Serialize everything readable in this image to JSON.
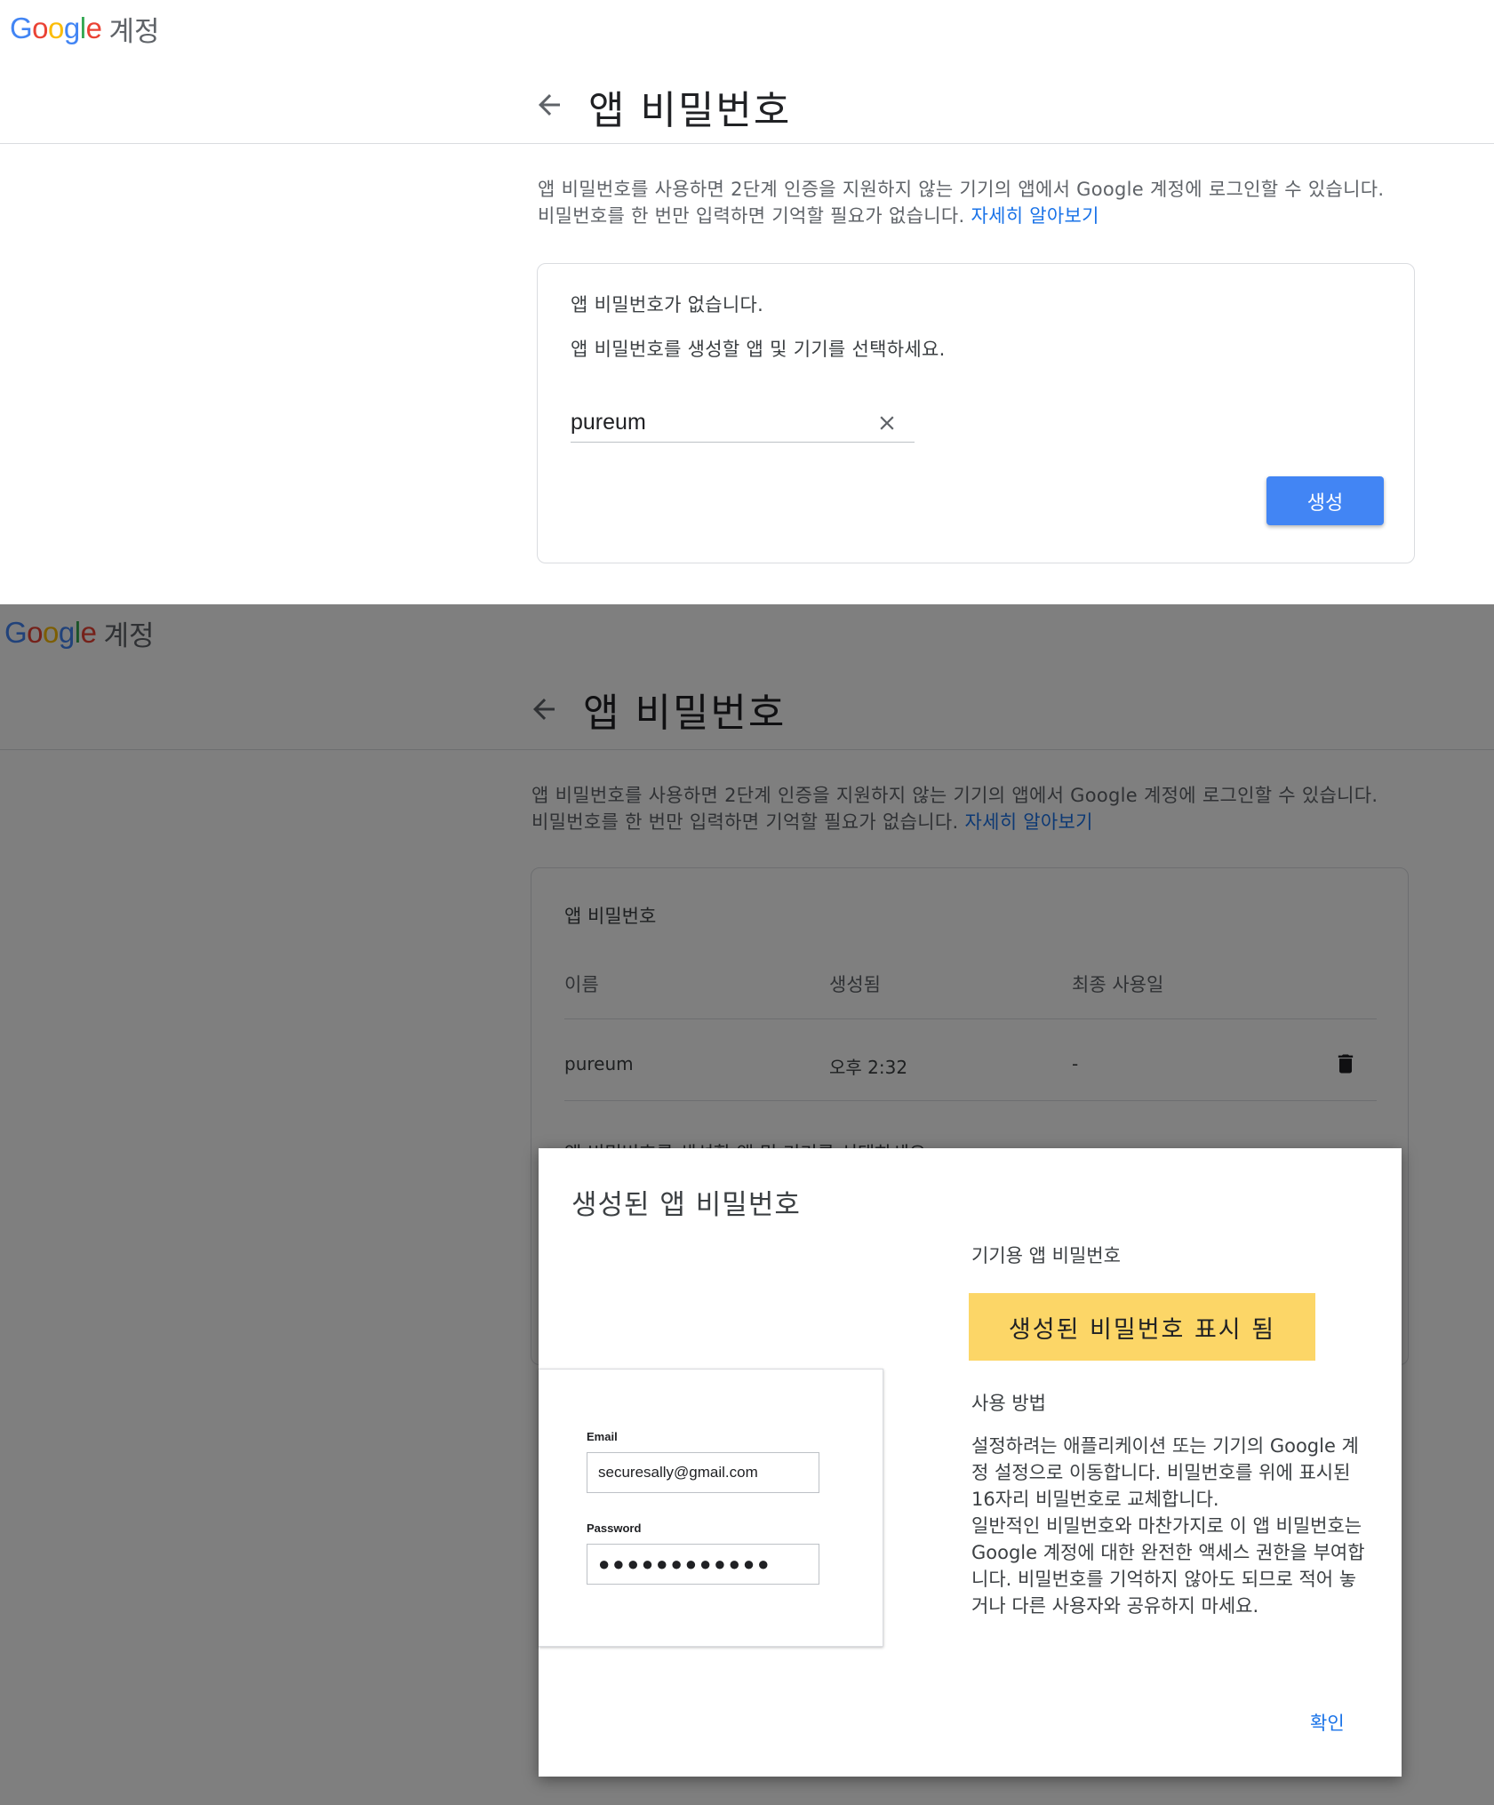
{
  "header": {
    "logo_text": "Google",
    "logo_sub": "계정"
  },
  "page": {
    "title": "앱 비밀번호",
    "desc_line1": "앱 비밀번호를 사용하면 2단계 인증을 지원하지 않는 기기의 앱에서 Google 계정에 로그인할 수 있습니다.",
    "desc_line2": "비밀번호를 한 번만 입력하면 기억할 필요가 없습니다.",
    "learn_more": "자세히 알아보기"
  },
  "panel1": {
    "no_passwords": "앱 비밀번호가 없습니다.",
    "select_prompt": "앱 비밀번호를 생성할 앱 및 기기를 선택하세요.",
    "app_name_value": "pureum",
    "generate_label": "생성"
  },
  "panel2": {
    "section_title": "앱 비밀번호",
    "columns": [
      "이름",
      "생성됨",
      "최종 사용일"
    ],
    "rows": [
      {
        "name": "pureum",
        "created": "오후 2:32",
        "last_used": "-"
      }
    ],
    "select_prompt": "앱 비밀번호를 생성할 앱 및 기기를 선택하세요."
  },
  "dialog": {
    "title": "생성된 앱 비밀번호",
    "device_label": "기기용 앱 비밀번호",
    "generated_password": "생성된 비밀번호 표시 됨",
    "usage_title": "사용 방법",
    "usage_body": "설정하려는 애플리케이션 또는 기기의 Google 계정 설정으로 이동합니다. 비밀번호를 위에 표시된 16자리 비밀번호로 교체합니다.\n일반적인 비밀번호와 마찬가지로 이 앱 비밀번호는 Google 계정에 대한 완전한 액세스 권한을 부여합니다. 비밀번호를 기억하지 않아도 되므로 적어 놓거나 다른 사용자와 공유하지 마세요.",
    "ok_label": "확인",
    "mock_email_label": "Email",
    "mock_email_value": "securesally@gmail.com",
    "mock_password_label": "Password",
    "mock_password_value": "●●●●●●●●●●●●"
  },
  "colors": {
    "accent": "#4285f4",
    "link": "#1a73e8",
    "highlight": "#fcd667"
  }
}
